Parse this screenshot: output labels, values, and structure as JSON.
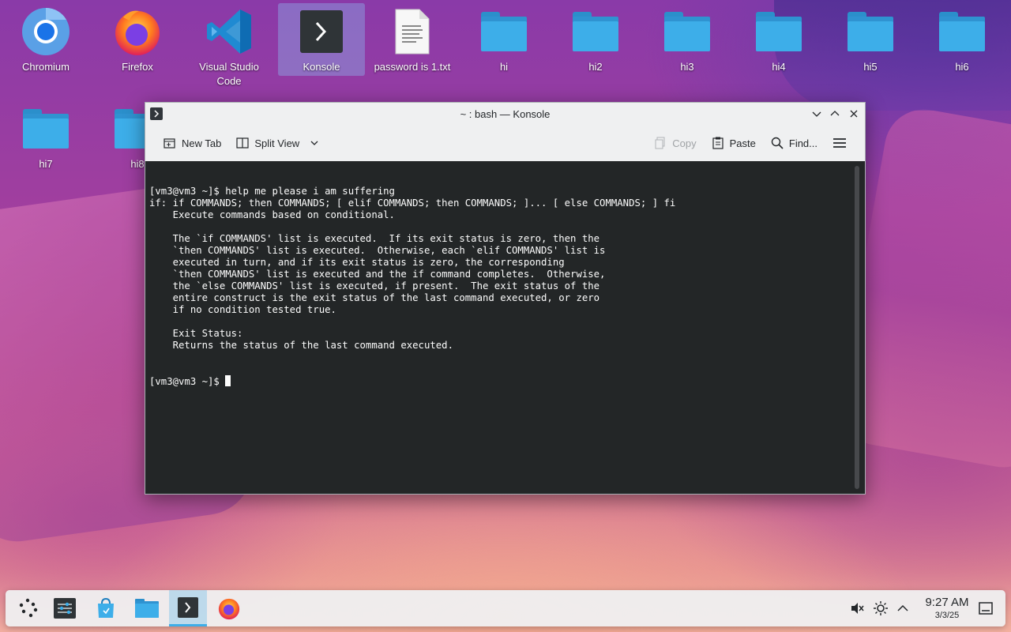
{
  "desktop": {
    "icons": [
      {
        "label": "Chromium",
        "icon": "chromium-icon"
      },
      {
        "label": "Firefox",
        "icon": "firefox-icon"
      },
      {
        "label": "Visual Studio Code",
        "icon": "vscode-icon"
      },
      {
        "label": "Konsole",
        "icon": "konsole-icon"
      },
      {
        "label": "password is 1.txt",
        "icon": "text-file-icon"
      },
      {
        "label": "hi",
        "icon": "folder-icon"
      },
      {
        "label": "hi2",
        "icon": "folder-icon"
      },
      {
        "label": "hi3",
        "icon": "folder-icon"
      },
      {
        "label": "hi4",
        "icon": "folder-icon"
      },
      {
        "label": "hi5",
        "icon": "folder-icon"
      },
      {
        "label": "hi6",
        "icon": "folder-icon"
      },
      {
        "label": "hi7",
        "icon": "folder-icon"
      },
      {
        "label": "hi8",
        "icon": "folder-icon"
      }
    ]
  },
  "window": {
    "title": "~ : bash — Konsole",
    "toolbar": {
      "new_tab": "New Tab",
      "split_view": "Split View",
      "copy": "Copy",
      "paste": "Paste",
      "find": "Find..."
    },
    "terminal_lines": [
      "[vm3@vm3 ~]$ help me please i am suffering",
      "if: if COMMANDS; then COMMANDS; [ elif COMMANDS; then COMMANDS; ]... [ else COMMANDS; ] fi",
      "    Execute commands based on conditional.",
      "",
      "    The `if COMMANDS' list is executed.  If its exit status is zero, then the",
      "    `then COMMANDS' list is executed.  Otherwise, each `elif COMMANDS' list is",
      "    executed in turn, and if its exit status is zero, the corresponding",
      "    `then COMMANDS' list is executed and the if command completes.  Otherwise,",
      "    the `else COMMANDS' list is executed, if present.  The exit status of the",
      "    entire construct is the exit status of the last command executed, or zero",
      "    if no condition tested true.",
      "",
      "    Exit Status:",
      "    Returns the status of the last command executed."
    ],
    "prompt": "[vm3@vm3 ~]$ "
  },
  "taskbar": {
    "time": "9:27 AM",
    "date": "3/3/25"
  },
  "colors": {
    "accent": "#3daee9",
    "terminal_bg": "#232627",
    "terminal_fg": "#fcfcfc"
  }
}
